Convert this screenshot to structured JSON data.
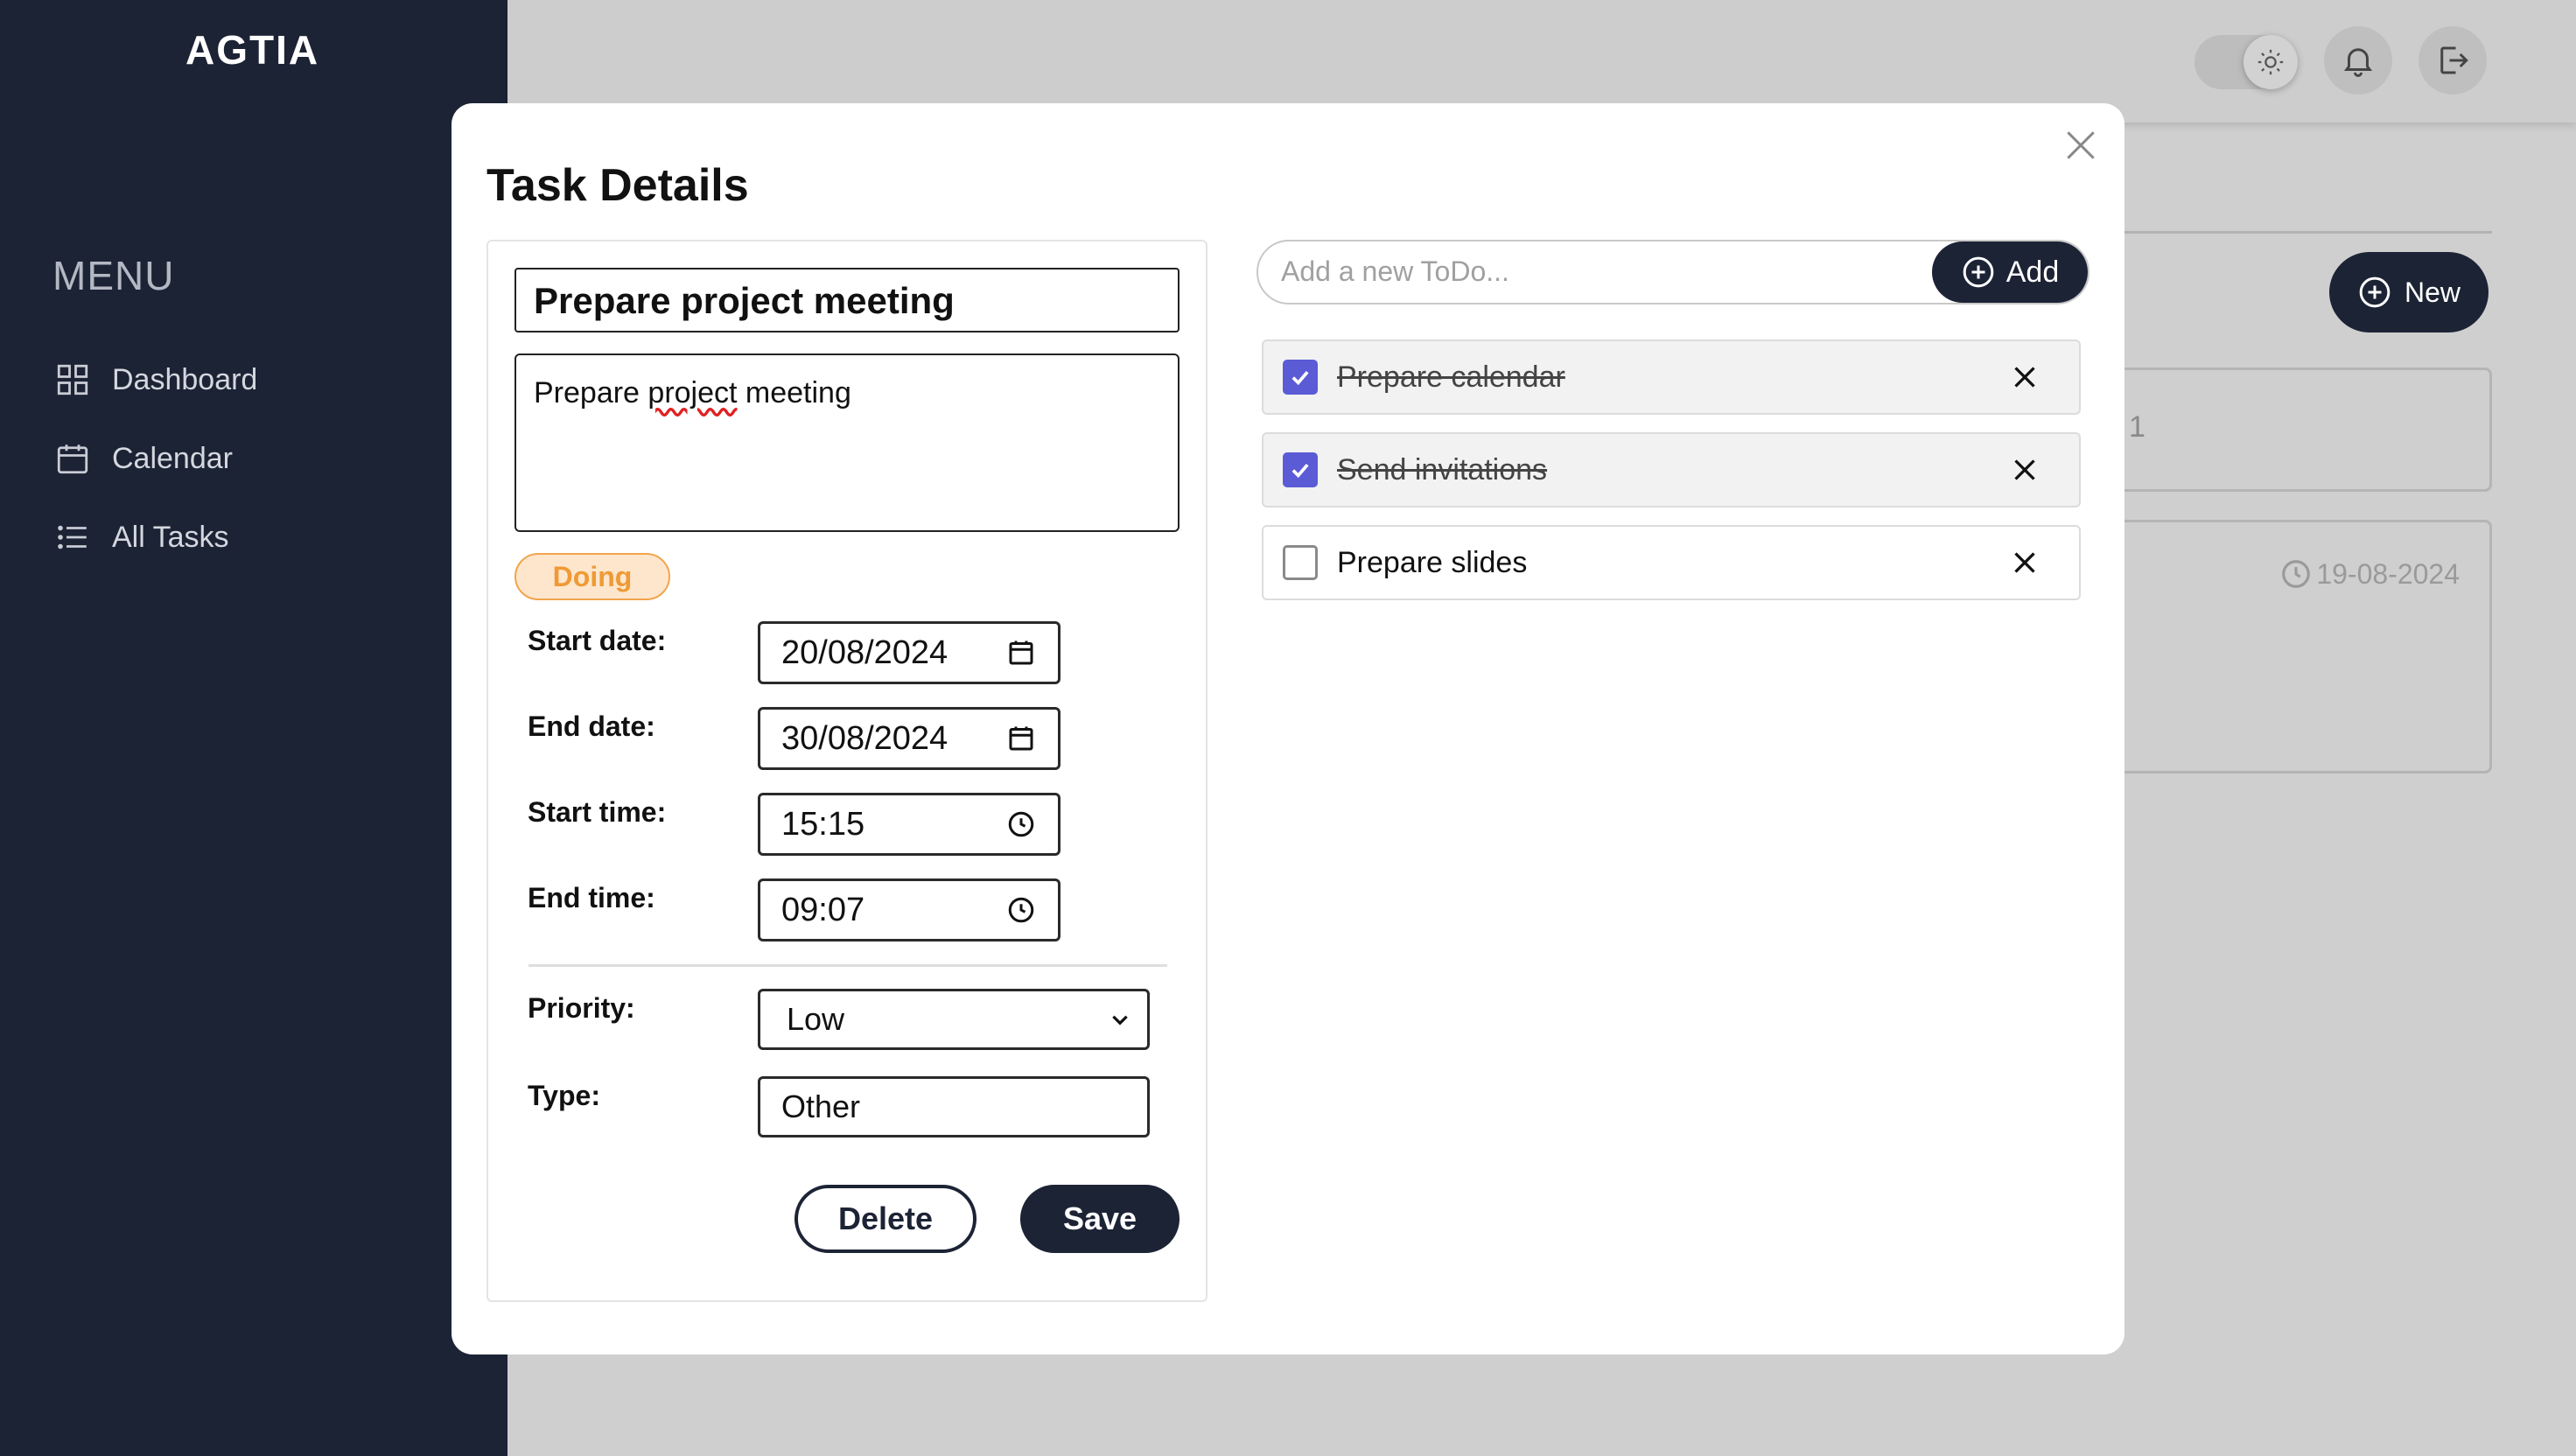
{
  "app": {
    "brand": "AGTIA"
  },
  "sidebar": {
    "menu_heading": "MENU",
    "items": [
      {
        "label": "Dashboard",
        "icon": "grid-icon"
      },
      {
        "label": "Calendar",
        "icon": "calendar-icon"
      },
      {
        "label": "All Tasks",
        "icon": "list-icon"
      }
    ]
  },
  "header": {
    "theme_toggle_icon": "sun-icon",
    "notifications_icon": "bell-icon",
    "logout_icon": "logout-icon"
  },
  "background": {
    "new_button_label": "New",
    "card_1_text": "1",
    "card_2_date": "19-08-2024"
  },
  "modal": {
    "title": "Task Details",
    "task_title": "Prepare project meeting",
    "description_parts": [
      "Prepare ",
      "project",
      " meeting"
    ],
    "status": "Doing",
    "fields": {
      "start_date": {
        "label": "Start date:",
        "value": "20/08/2024"
      },
      "end_date": {
        "label": "End date:",
        "value": "30/08/2024"
      },
      "start_time": {
        "label": "Start time:",
        "value": "15:15"
      },
      "end_time": {
        "label": "End time:",
        "value": "09:07"
      },
      "priority": {
        "label": "Priority:",
        "value": "Low"
      },
      "type": {
        "label": "Type:",
        "value": "Other"
      }
    },
    "delete_label": "Delete",
    "save_label": "Save"
  },
  "todos": {
    "placeholder": "Add a new ToDo...",
    "add_label": "Add",
    "items": [
      {
        "label": "Prepare calendar",
        "done": true
      },
      {
        "label": "Send invitations",
        "done": true
      },
      {
        "label": "Prepare slides",
        "done": false
      }
    ]
  },
  "colors": {
    "sidebar_bg": "#1c2335",
    "accent_dark": "#1c2335",
    "checkbox_checked": "#5b5bd6",
    "status_doing": "#ef9a35",
    "status_doing_bg": "#fde6cc"
  }
}
